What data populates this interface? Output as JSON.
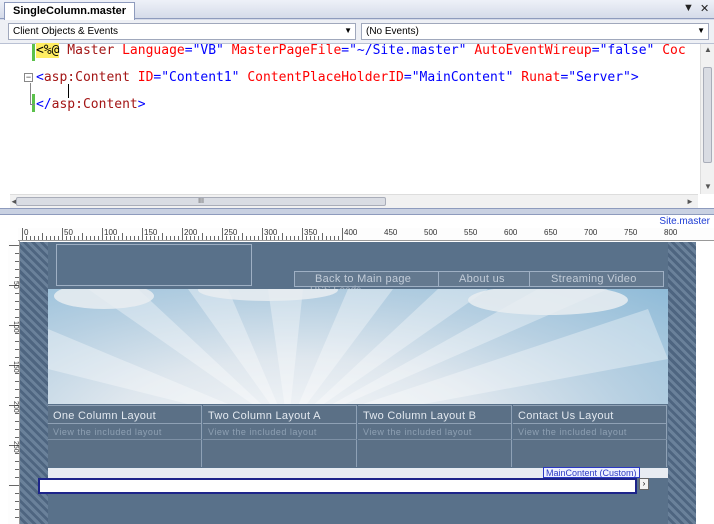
{
  "tab": {
    "title": "SingleColumn.master",
    "dropdown_glyph": "▼",
    "close_glyph": "✕"
  },
  "dropdowns": {
    "left": "Client Objects & Events",
    "right": "(No Events)",
    "arrow": "▼"
  },
  "code": {
    "line1": {
      "open": "<%@",
      "directive": " Master",
      "a1": " Language",
      "v1": "\"VB\"",
      "a2": " MasterPageFile",
      "v2": "\"~/Site.master\"",
      "a3": " AutoEventWireup",
      "v3": "\"false\"",
      "a4": " Coc"
    },
    "line2": {
      "open": "<",
      "tag": "asp:Content",
      "a1": " ID",
      "v1": "\"Content1\"",
      "a2": " ContentPlaceHolderID",
      "v2": "\"MainContent\"",
      "a3": " Runat",
      "v3": "\"Server\"",
      "close": ">"
    },
    "line3": {
      "open": "</",
      "tag": "asp:Content",
      "close": ">"
    },
    "eq": "=",
    "collapse_glyph": "−"
  },
  "scroll": {
    "thumb_glyph": "III",
    "up": "▲",
    "down": "▼",
    "left": "◄",
    "right": "►"
  },
  "design": {
    "site_label": "Site.master",
    "ruler_labels": [
      "0",
      "50",
      "100",
      "150",
      "200",
      "250",
      "300",
      "350",
      "400",
      "450",
      "500",
      "550",
      "600",
      "650",
      "700",
      "750",
      "800"
    ],
    "vruler_labels": [
      "50",
      "100",
      "150",
      "200",
      "250"
    ],
    "nav": [
      "Back to Main page",
      "About us",
      "Streaming Video"
    ],
    "nav_extra": "RSS Feeds",
    "columns": [
      {
        "title": "One Column Layout",
        "sub": "View the included layout"
      },
      {
        "title": "Two Column Layout A",
        "sub": "View the included layout"
      },
      {
        "title": "Two Column Layout B",
        "sub": "View the included layout"
      },
      {
        "title": "Contact Us Layout",
        "sub": "View the included layout"
      }
    ],
    "placeholder_tag": "MainContent (Custom)",
    "placeholder_arrow": "›"
  }
}
